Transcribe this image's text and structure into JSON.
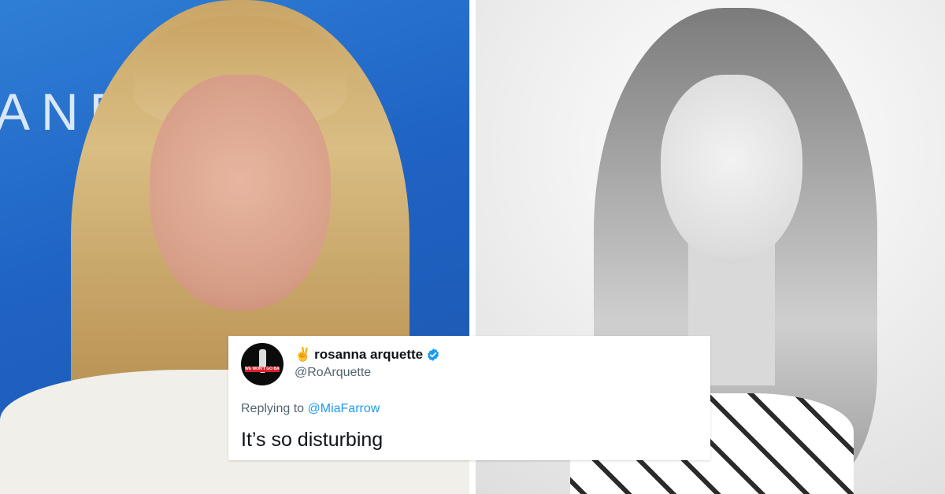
{
  "left_photo": {
    "backdrop_text": "ANE"
  },
  "tweet": {
    "avatar_text": "WE WON'T GO BACK",
    "emoji": "✌",
    "name": "rosanna arquette",
    "handle": "@RoArquette",
    "replying_prefix": "Replying to",
    "replying_to": "@MiaFarrow",
    "text": "It’s so disturbing"
  },
  "colors": {
    "left_backdrop": "#1f63c4",
    "verified": "#1d9bf0",
    "mention": "#1d9bf0"
  },
  "icons": {
    "verified": "verified-badge-icon",
    "peace": "peace-hand-icon"
  }
}
